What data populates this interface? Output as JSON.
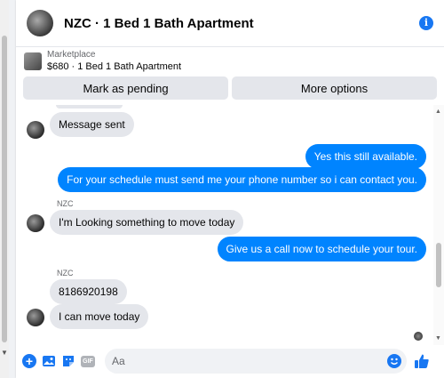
{
  "header": {
    "title": "NZC · 1 Bed 1 Bath Apartment",
    "info_icon_glyph": "i"
  },
  "listing": {
    "source": "Marketplace",
    "summary": "$680 · 1 Bed 1 Bath Apartment"
  },
  "actions": {
    "pending": "Mark as pending",
    "more": "More options"
  },
  "messages": [
    {
      "dir": "in",
      "text": "Message sent",
      "avatar": true
    },
    {
      "dir": "out",
      "text": "Yes this still available."
    },
    {
      "dir": "out",
      "text": "For your schedule must send me your phone number so i can contact you."
    },
    {
      "dir": "in",
      "sender": "NZC",
      "text": "I'm Looking something to move today",
      "avatar": true
    },
    {
      "dir": "out",
      "text": "Give us a call now to schedule your tour."
    },
    {
      "dir": "in",
      "sender": "NZC",
      "text": "8186920198"
    },
    {
      "dir": "in",
      "text": "I can move today",
      "avatar": true
    }
  ],
  "composer": {
    "placeholder": "Aa",
    "gif_label": "GIF",
    "plus_glyph": "+"
  },
  "colors": {
    "accent": "#1877f2",
    "outgoing": "#0084ff",
    "incoming": "#e4e6eb"
  },
  "icons": [
    "plus-icon",
    "photo-icon",
    "sticker-icon",
    "gif-icon",
    "emoji-icon",
    "thumbs-up-icon",
    "info-icon"
  ]
}
